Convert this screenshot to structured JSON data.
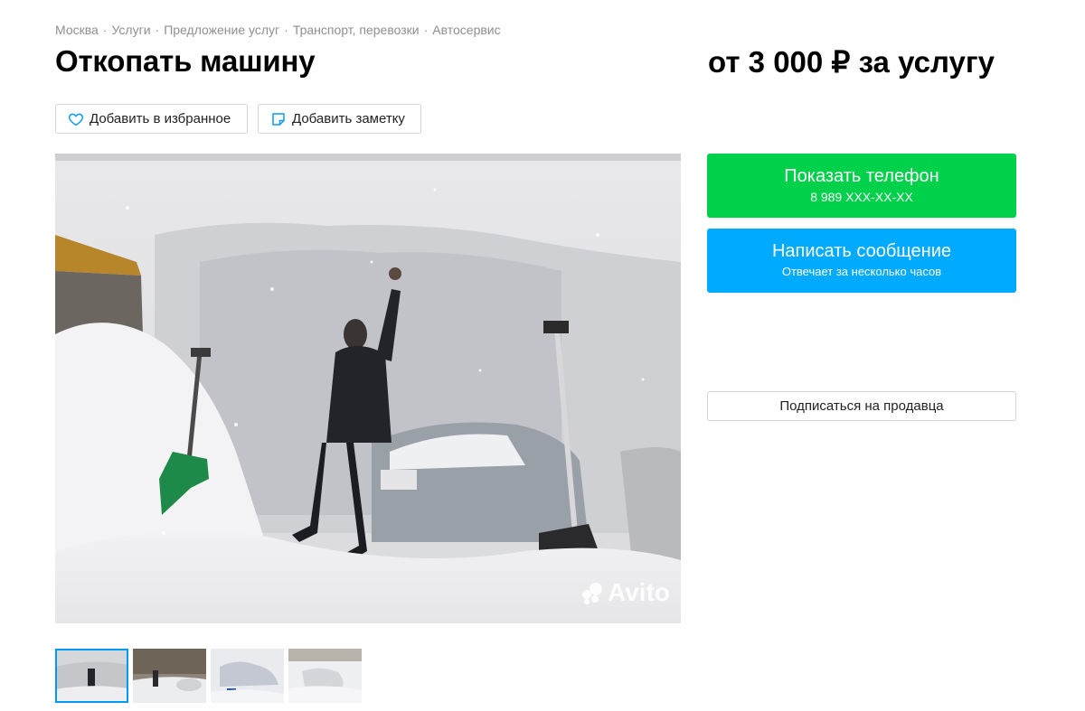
{
  "breadcrumbs": [
    "Москва",
    "Услуги",
    "Предложение услуг",
    "Транспорт, перевозки",
    "Автосервис"
  ],
  "title": "Откопать машину",
  "price": "от 3 000 ₽ за услугу",
  "actions": {
    "favorite_label": "Добавить в избранное",
    "note_label": "Добавить заметку"
  },
  "photo": {
    "watermark": "Avito"
  },
  "contact": {
    "call_label": "Показать телефон",
    "call_phone": "8 989 XXX-XX-XX",
    "message_label": "Написать сообщение",
    "message_sub": "Отвечает за несколько часов",
    "subscribe_label": "Подписаться на продавца"
  },
  "colors": {
    "call_bg": "#00d14a",
    "message_bg": "#00aaff",
    "active_thumb_border": "#0099f7"
  }
}
